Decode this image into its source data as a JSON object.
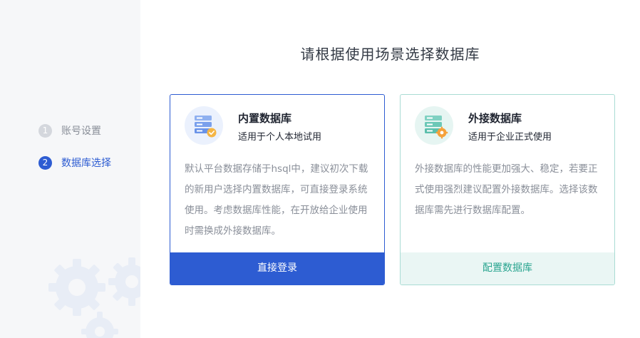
{
  "sidebar": {
    "steps": [
      {
        "num": "1",
        "label": "账号设置",
        "state": "inactive"
      },
      {
        "num": "2",
        "label": "数据库选择",
        "state": "active"
      }
    ]
  },
  "main": {
    "title": "请根据使用场景选择数据库"
  },
  "cards": {
    "internal": {
      "icon": "database-check-icon",
      "title": "内置数据库",
      "subtitle": "适用于个人本地试用",
      "description": "默认平台数据存储于hsql中，建议初次下载的新用户选择内置数据库，可直接登录系统使用。考虑数据库性能，在开放给企业使用时需换成外接数据库。",
      "button": "直接登录"
    },
    "external": {
      "icon": "database-gear-icon",
      "title": "外接数据库",
      "subtitle": "适用于企业正式使用",
      "description": "外接数据库的性能更加强大、稳定，若要正式使用强烈建议配置外接数据库。选择该数据库需先进行数据库配置。",
      "button": "配置数据库"
    }
  },
  "colors": {
    "primary": "#2d5cd2",
    "teal": "#2aa590",
    "sidebar_bg": "#f6f7f9"
  }
}
